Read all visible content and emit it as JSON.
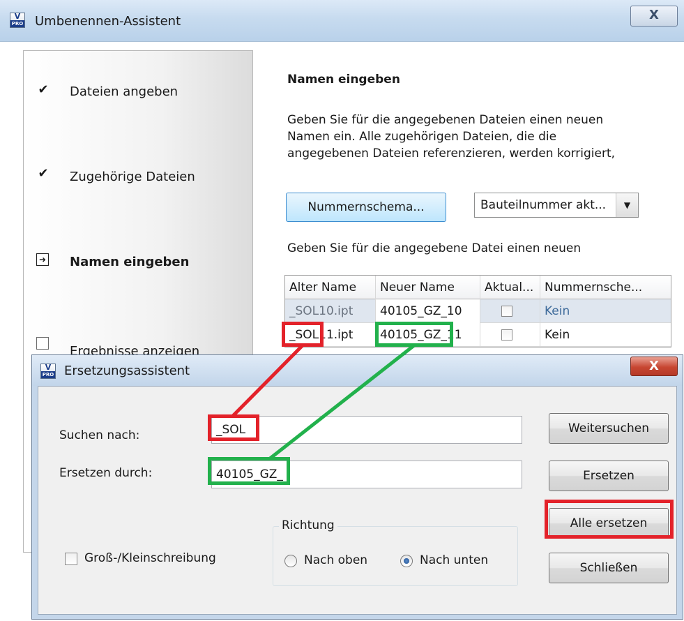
{
  "main_window": {
    "title": "Umbenennen-Assistent",
    "close_glyph": "X",
    "steps": [
      {
        "label": "Dateien angeben",
        "state": "done"
      },
      {
        "label": "Zugehörige Dateien",
        "state": "done"
      },
      {
        "label": "Namen eingeben",
        "state": "current"
      },
      {
        "label": "Ergebnisse anzeigen",
        "state": "pending"
      }
    ],
    "heading": "Namen eingeben",
    "description": [
      "Geben Sie für die angegebenen Dateien einen neuen",
      "Namen ein. Alle zugehörigen Dateien, die die",
      "angegebenen Dateien referenzieren, werden korrigiert,"
    ],
    "scheme_button": "Nummernschema...",
    "combo_value": "Bauteilnummer akt...",
    "grid_intro": "Geben Sie für die angegebene Datei einen neuen",
    "grid": {
      "columns": [
        "Alter Name",
        "Neuer Name",
        "Aktual...",
        "Nummernsche..."
      ],
      "rows": [
        {
          "old": "_SOL10.ipt",
          "new": "40105_GZ_10",
          "checked": false,
          "scheme": "Kein"
        },
        {
          "old": "_SOL11.ipt",
          "new": "40105_GZ_11",
          "checked": false,
          "scheme": "Kein"
        }
      ]
    }
  },
  "dialog": {
    "title": "Ersetzungsassistent",
    "close_glyph": "X",
    "find_label": "Suchen nach:",
    "find_value": "_SOL",
    "replace_label": "Ersetzen durch:",
    "replace_value": "40105_GZ_",
    "buttons": {
      "find_next": "Weitersuchen",
      "replace": "Ersetzen",
      "replace_all": "Alle ersetzen",
      "close": "Schließen"
    },
    "match_case_label": "Groß-/Kleinschreibung",
    "direction": {
      "title": "Richtung",
      "up": "Nach oben",
      "down": "Nach unten",
      "selected": "down"
    }
  },
  "colors": {
    "highlight_red": "#e3222a",
    "highlight_green": "#22b14c"
  }
}
